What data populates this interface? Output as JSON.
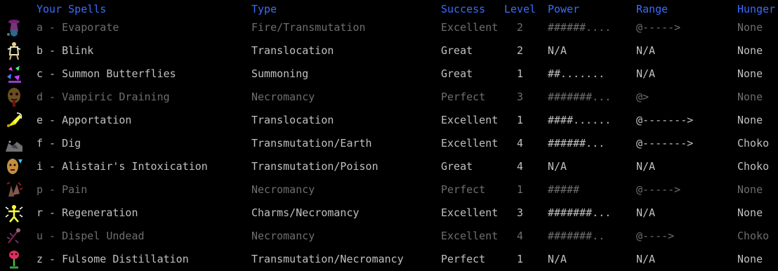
{
  "headers": {
    "name": "Your Spells",
    "type": "Type",
    "success": "Success",
    "level": "Level",
    "power": "Power",
    "range": "Range",
    "hunger": "Hunger"
  },
  "spells": [
    {
      "label": "a - Evaporate",
      "type": "Fire/Transmutation",
      "success": "Excellent",
      "level": "2",
      "power": "######....",
      "range": "@----->",
      "hunger": "None",
      "dim": true,
      "icon": "evaporate-icon"
    },
    {
      "label": "b - Blink",
      "type": "Translocation",
      "success": "Great",
      "level": "2",
      "power": "N/A",
      "range": "N/A",
      "hunger": "None",
      "dim": false,
      "icon": "blink-icon"
    },
    {
      "label": "c - Summon Butterflies",
      "type": "Summoning",
      "success": "Great",
      "level": "1",
      "power": "##.......",
      "range": "N/A",
      "hunger": "None",
      "dim": false,
      "icon": "butterflies-icon"
    },
    {
      "label": "d - Vampiric Draining",
      "type": "Necromancy",
      "success": "Perfect",
      "level": "3",
      "power": "#######...",
      "range": "@>",
      "hunger": "None",
      "dim": true,
      "icon": "vampiric-draining-icon"
    },
    {
      "label": "e - Apportation",
      "type": "Translocation",
      "success": "Excellent",
      "level": "1",
      "power": "####......",
      "range": "@------->",
      "hunger": "None",
      "dim": false,
      "icon": "apportation-icon"
    },
    {
      "label": "f - Dig",
      "type": "Transmutation/Earth",
      "success": "Excellent",
      "level": "4",
      "power": "######...",
      "range": "@------->",
      "hunger": "Choko",
      "dim": false,
      "icon": "dig-icon"
    },
    {
      "label": "i - Alistair's Intoxication",
      "type": "Transmutation/Poison",
      "success": "Great",
      "level": "4",
      "power": "N/A",
      "range": "N/A",
      "hunger": "Choko",
      "dim": false,
      "icon": "intoxication-icon"
    },
    {
      "label": "p - Pain",
      "type": "Necromancy",
      "success": "Perfect",
      "level": "1",
      "power": "#####",
      "range": "@----->",
      "hunger": "None",
      "dim": true,
      "icon": "pain-icon"
    },
    {
      "label": "r - Regeneration",
      "type": "Charms/Necromancy",
      "success": "Excellent",
      "level": "3",
      "power": "#######...",
      "range": "N/A",
      "hunger": "None",
      "dim": false,
      "icon": "regeneration-icon"
    },
    {
      "label": "u - Dispel Undead",
      "type": "Necromancy",
      "success": "Excellent",
      "level": "4",
      "power": "#######..",
      "range": "@---->",
      "hunger": "Choko",
      "dim": true,
      "icon": "dispel-undead-icon"
    },
    {
      "label": "z - Fulsome Distillation",
      "type": "Transmutation/Necromancy",
      "success": "Perfect",
      "level": "1",
      "power": "N/A",
      "range": "N/A",
      "hunger": "None",
      "dim": false,
      "icon": "fulsome-distillation-icon"
    }
  ]
}
